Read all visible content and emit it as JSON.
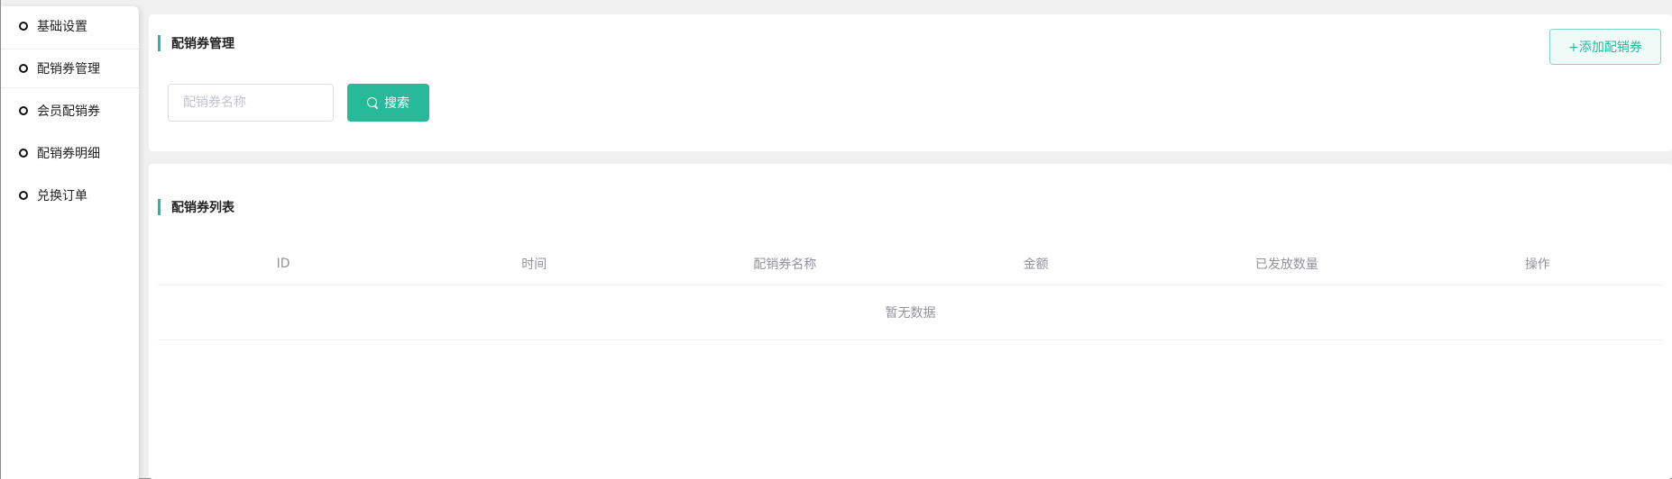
{
  "sidebar": {
    "items": [
      {
        "label": "基础设置",
        "active": false
      },
      {
        "label": "配销券管理",
        "active": true
      },
      {
        "label": "会员配销券",
        "active": false
      },
      {
        "label": "配销券明细",
        "active": false
      },
      {
        "label": "兑换订单",
        "active": false
      }
    ]
  },
  "manage": {
    "title": "配销券管理",
    "add_button": "+添加配销券",
    "search": {
      "placeholder": "配销券名称",
      "value": "",
      "button": "搜索"
    }
  },
  "list": {
    "title": "配销券列表",
    "columns": [
      "ID",
      "时间",
      "配销券名称",
      "金额",
      "已发放数量",
      "操作"
    ],
    "rows": [],
    "empty_text": "暂无数据"
  },
  "colors": {
    "accent": "#26b99a",
    "page_bg": "#f0f0f0"
  },
  "icons": {
    "sidebar_item": "circle-icon",
    "search_button": "search-icon"
  }
}
